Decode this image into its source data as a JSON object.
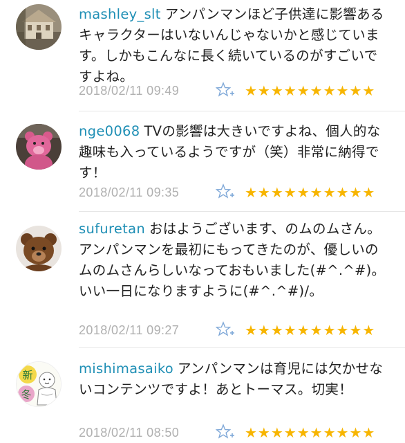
{
  "comments": [
    {
      "username": "mashley_slt",
      "text": "アンパンマンほど子供達に影響あるキャラクターはいないんじゃないかと感じています。しかもこんなに長く続いているのがすごいですよね。",
      "timestamp": "2018/02/11 09:49",
      "stars": "★★★★★★★★★★",
      "avatar_icon": "house-avatar-icon"
    },
    {
      "username": "nge0068",
      "text": "TVの影響は大きいですよね、個人的な趣味も入っているようですが（笑）非常に納得です！",
      "timestamp": "2018/02/11 09:35",
      "stars": "★★★★★★★★★★",
      "avatar_icon": "pink-bear-avatar-icon"
    },
    {
      "username": "sufuretan",
      "text": "おはようございます、のムのムさん。アンパンマンを最初にもってきたのが、優しいのムのムさんらしいなっておもいました(#^.^#)。いい一日になりますように(#^.^#)/。",
      "timestamp": "2018/02/11 09:27",
      "stars": "★★★★★★★★★★",
      "avatar_icon": "teddy-bear-avatar-icon"
    },
    {
      "username": "mishimasaiko",
      "text": "アンパンマンは育児には欠かせないコンテンツですよ！あとトーマス。切実！",
      "timestamp": "2018/02/11 08:50",
      "stars": "★★★★★★★★★★",
      "avatar_icon": "new-winter-baby-avatar-icon",
      "avatar_text": "新冬"
    }
  ],
  "colors": {
    "username": "#1f8fb5",
    "timestamp": "#b0b0b0",
    "star": "#f7b500",
    "star_add": "#7fa8d8",
    "divider": "#e6e6e6"
  }
}
